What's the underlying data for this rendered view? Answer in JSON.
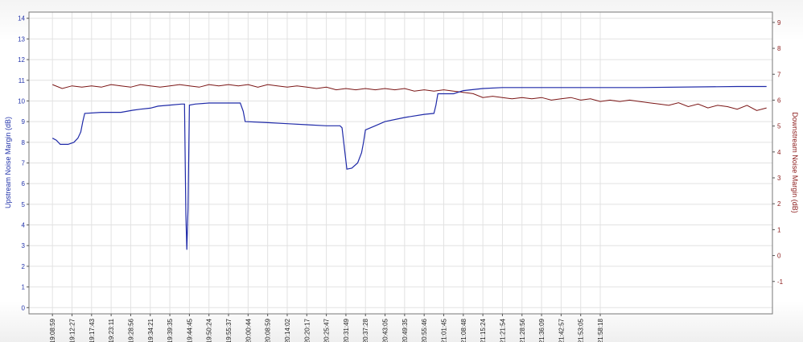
{
  "chart_data": {
    "type": "line",
    "title": "",
    "y_left_label": "Upstream Noise Margin (dB)",
    "y_right_label": "Downstream Noise Margin (dB)",
    "y_left_lim": [
      -0.3,
      14.3
    ],
    "y_right_lim": [
      -2.25,
      9.4
    ],
    "y_left_ticks": [
      "0",
      "1",
      "2",
      "3",
      "4",
      "5",
      "6",
      "7",
      "8",
      "9",
      "10",
      "11",
      "12",
      "13",
      "14"
    ],
    "y_right_ticks": [
      "-1",
      "0",
      "1",
      "2",
      "3",
      "4",
      "5",
      "6",
      "7",
      "8",
      "9"
    ],
    "x_tick_labels": [
      "19:08:59",
      "19:12:27",
      "19:17:43",
      "19:23:11",
      "19:28:56",
      "19:34:21",
      "19:39:35",
      "19:44:45",
      "19:50:24",
      "19:55:37",
      "20:00:44",
      "20:08:59",
      "20:14:02",
      "20:20:17",
      "20:25:47",
      "20:31:49",
      "20:37:28",
      "20:43:05",
      "20:49:35",
      "20:55:46",
      "21:01:45",
      "21:08:48",
      "21:15:24",
      "21:21:54",
      "21:28:56",
      "21:36:09",
      "21:42:57",
      "21:53:05",
      "21:58:18"
    ],
    "x_range": [
      -1.2,
      36.8
    ],
    "grid": true,
    "colors": {
      "upstream": "#1f2aa8",
      "downstream": "#7a1414",
      "left_axis": "#2233aa",
      "right_axis": "#8b1a1a",
      "grid": "#e2e2e2"
    },
    "series": [
      {
        "axis": "left",
        "points": [
          [
            0,
            8.2
          ],
          [
            0.2,
            8.1
          ],
          [
            0.4,
            7.9
          ],
          [
            0.8,
            7.9
          ],
          [
            1.1,
            8.0
          ],
          [
            1.3,
            8.2
          ],
          [
            1.45,
            8.5
          ],
          [
            1.55,
            9.0
          ],
          [
            1.65,
            9.4
          ],
          [
            2.5,
            9.45
          ],
          [
            3.5,
            9.45
          ],
          [
            4.1,
            9.55
          ],
          [
            4.5,
            9.6
          ],
          [
            5.0,
            9.65
          ],
          [
            5.4,
            9.75
          ],
          [
            6.0,
            9.8
          ],
          [
            6.6,
            9.85
          ],
          [
            6.75,
            9.85
          ],
          [
            6.82,
            4.5
          ],
          [
            6.87,
            2.8
          ],
          [
            6.93,
            4.8
          ],
          [
            7.0,
            9.8
          ],
          [
            7.3,
            9.85
          ],
          [
            8.0,
            9.9
          ],
          [
            9.0,
            9.9
          ],
          [
            9.6,
            9.9
          ],
          [
            9.75,
            9.5
          ],
          [
            9.85,
            9.0
          ],
          [
            11.0,
            8.95
          ],
          [
            12.0,
            8.9
          ],
          [
            13.0,
            8.85
          ],
          [
            14.0,
            8.8
          ],
          [
            14.7,
            8.8
          ],
          [
            14.8,
            8.7
          ],
          [
            14.95,
            7.5
          ],
          [
            15.05,
            6.7
          ],
          [
            15.3,
            6.75
          ],
          [
            15.6,
            7.0
          ],
          [
            15.8,
            7.5
          ],
          [
            15.9,
            8.0
          ],
          [
            16.0,
            8.6
          ],
          [
            16.5,
            8.8
          ],
          [
            17.0,
            9.0
          ],
          [
            18.0,
            9.2
          ],
          [
            19.0,
            9.35
          ],
          [
            19.5,
            9.4
          ],
          [
            19.6,
            9.8
          ],
          [
            19.7,
            10.35
          ],
          [
            20.5,
            10.35
          ],
          [
            21.0,
            10.5
          ],
          [
            22.0,
            10.6
          ],
          [
            23.0,
            10.65
          ],
          [
            25.0,
            10.65
          ],
          [
            30.0,
            10.65
          ],
          [
            35.0,
            10.7
          ],
          [
            36.5,
            10.7
          ]
        ]
      },
      {
        "axis": "right",
        "points": [
          [
            0,
            6.6
          ],
          [
            0.5,
            6.45
          ],
          [
            1.0,
            6.55
          ],
          [
            1.5,
            6.5
          ],
          [
            2.0,
            6.55
          ],
          [
            2.5,
            6.5
          ],
          [
            3.0,
            6.6
          ],
          [
            3.5,
            6.55
          ],
          [
            4.0,
            6.5
          ],
          [
            4.5,
            6.6
          ],
          [
            5.0,
            6.55
          ],
          [
            5.5,
            6.5
          ],
          [
            6.0,
            6.55
          ],
          [
            6.5,
            6.6
          ],
          [
            7.0,
            6.55
          ],
          [
            7.5,
            6.5
          ],
          [
            8.0,
            6.6
          ],
          [
            8.5,
            6.55
          ],
          [
            9.0,
            6.6
          ],
          [
            9.5,
            6.55
          ],
          [
            10.0,
            6.6
          ],
          [
            10.5,
            6.5
          ],
          [
            11.0,
            6.6
          ],
          [
            11.5,
            6.55
          ],
          [
            12.0,
            6.5
          ],
          [
            12.5,
            6.55
          ],
          [
            13.0,
            6.5
          ],
          [
            13.5,
            6.45
          ],
          [
            14.0,
            6.5
          ],
          [
            14.5,
            6.4
          ],
          [
            15.0,
            6.45
          ],
          [
            15.5,
            6.4
          ],
          [
            16.0,
            6.45
          ],
          [
            16.5,
            6.4
          ],
          [
            17.0,
            6.45
          ],
          [
            17.5,
            6.4
          ],
          [
            18.0,
            6.45
          ],
          [
            18.5,
            6.35
          ],
          [
            19.0,
            6.4
          ],
          [
            19.5,
            6.35
          ],
          [
            20.0,
            6.4
          ],
          [
            20.5,
            6.35
          ],
          [
            21.0,
            6.3
          ],
          [
            21.5,
            6.25
          ],
          [
            22.0,
            6.1
          ],
          [
            22.5,
            6.15
          ],
          [
            23.0,
            6.1
          ],
          [
            23.5,
            6.05
          ],
          [
            24.0,
            6.1
          ],
          [
            24.5,
            6.05
          ],
          [
            25.0,
            6.1
          ],
          [
            25.5,
            6.0
          ],
          [
            26.0,
            6.05
          ],
          [
            26.5,
            6.1
          ],
          [
            27.0,
            6.0
          ],
          [
            27.5,
            6.05
          ],
          [
            28.0,
            5.95
          ],
          [
            28.5,
            6.0
          ],
          [
            29.0,
            5.95
          ],
          [
            29.5,
            6.0
          ],
          [
            30.0,
            5.95
          ],
          [
            30.5,
            5.9
          ],
          [
            31.0,
            5.85
          ],
          [
            31.5,
            5.8
          ],
          [
            32.0,
            5.9
          ],
          [
            32.5,
            5.75
          ],
          [
            33.0,
            5.85
          ],
          [
            33.5,
            5.7
          ],
          [
            34.0,
            5.8
          ],
          [
            34.5,
            5.75
          ],
          [
            35.0,
            5.65
          ],
          [
            35.5,
            5.8
          ],
          [
            36.0,
            5.6
          ],
          [
            36.5,
            5.7
          ]
        ]
      }
    ]
  }
}
